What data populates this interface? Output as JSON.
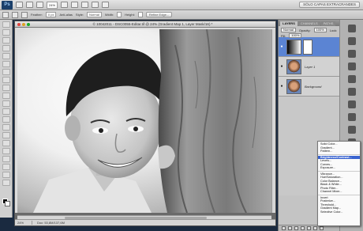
{
  "app": {
    "logo": "Ps",
    "zoom": "24%",
    "workspace": "SÓLO CAPAS EXTRACRANDES"
  },
  "options": {
    "feather_label": "Feather:",
    "feather_value": "0 px",
    "antialias_label": "Anti-alias",
    "style_label": "Style:",
    "style_value": "Normal",
    "width_label": "Width:",
    "height_label": "Height:",
    "refine_button": "Refine Edge..."
  },
  "document": {
    "title": "© 10042011 - DSC0055-Editar.tif @ 24% (Gradient Map 1, Layer Mask/16) *",
    "status_zoom": "24%",
    "status_info": "Doc: 53,8M/137,6M"
  },
  "panel": {
    "tabs": [
      "LAYERS",
      "CHANNELS",
      "PATHS"
    ],
    "blend_mode": "Normal",
    "opacity_label": "Opacity:",
    "opacity_value": "100%",
    "lock_label": "Lock:",
    "fill_label": "Fill:",
    "fill_value": "100%",
    "layers": [
      {
        "name": "",
        "type": "adjustment"
      },
      {
        "name": "Layer 1",
        "type": "photo"
      },
      {
        "name": "Background",
        "type": "photo"
      }
    ]
  },
  "adjust_menu": {
    "items": [
      "Solid Color...",
      "Gradient...",
      "Pattern...",
      "Brightness/Contrast...",
      "Levels...",
      "Curves...",
      "Exposure...",
      "Vibrance...",
      "Hue/Saturation...",
      "Color Balance...",
      "Black & White...",
      "Photo Filter...",
      "Channel Mixer...",
      "Invert",
      "Posterize...",
      "Threshold...",
      "Gradient Map...",
      "Selective Color..."
    ],
    "highlighted_index": 3
  }
}
